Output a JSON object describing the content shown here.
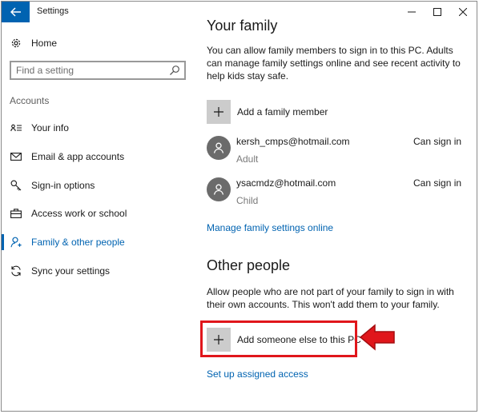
{
  "window": {
    "title": "Settings",
    "back_icon": "back-arrow-icon",
    "controls": [
      "minimize-icon",
      "maximize-icon",
      "close-icon"
    ]
  },
  "sidebar": {
    "home_label": "Home",
    "search_placeholder": "Find a setting",
    "section_label": "Accounts",
    "items": [
      {
        "label": "Your info",
        "icon": "contact-card-icon",
        "selected": false
      },
      {
        "label": "Email & app accounts",
        "icon": "mail-icon",
        "selected": false
      },
      {
        "label": "Sign-in options",
        "icon": "key-icon",
        "selected": false
      },
      {
        "label": "Access work or school",
        "icon": "briefcase-icon",
        "selected": false
      },
      {
        "label": "Family & other people",
        "icon": "person-icon",
        "selected": true
      },
      {
        "label": "Sync your settings",
        "icon": "sync-icon",
        "selected": false
      }
    ]
  },
  "main": {
    "family_heading": "Your family",
    "family_description": "You can allow family members to sign in to this PC. Adults can manage family settings online and see recent activity to help kids stay safe.",
    "add_family_label": "Add a family member",
    "members": [
      {
        "email": "kersh_cmps@hotmail.com",
        "role": "Adult",
        "status": "Can sign in"
      },
      {
        "email": "ysacmdz@hotmail.com",
        "role": "Child",
        "status": "Can sign in"
      }
    ],
    "manage_link": "Manage family settings online",
    "other_heading": "Other people",
    "other_description": "Allow people who are not part of your family to sign in with their own accounts. This won't add them to your family.",
    "add_other_label": "Add someone else to this PC",
    "assigned_access_link": "Set up assigned access"
  },
  "colors": {
    "accent": "#0063b1",
    "annotation": "#e0161b"
  }
}
